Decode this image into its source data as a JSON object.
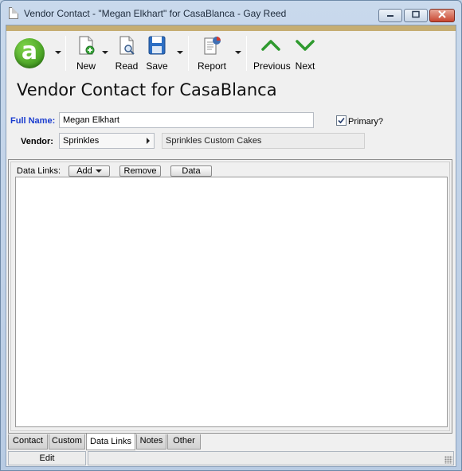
{
  "window": {
    "title": "Vendor Contact - \"Megan Elkhart\" for CasaBlanca - Gay Reed",
    "minimize_icon": "minimize-icon",
    "maximize_icon": "maximize-icon",
    "close_icon": "close-icon"
  },
  "toolbar": {
    "logo_letter": "a",
    "new_label": "New",
    "read_label": "Read",
    "save_label": "Save",
    "report_label": "Report",
    "previous_label": "Previous",
    "next_label": "Next"
  },
  "form": {
    "heading": "Vendor Contact for CasaBlanca",
    "full_name_label": "Full Name:",
    "full_name_value": "Megan Elkhart",
    "primary_label": "Primary?",
    "primary_checked": true,
    "vendor_label": "Vendor:",
    "vendor_value": "Sprinkles",
    "vendor_description": "Sprinkles Custom Cakes"
  },
  "data_links": {
    "label": "Data Links:",
    "add_label": "Add",
    "remove_label": "Remove",
    "data_label": "Data"
  },
  "tabs": [
    {
      "label": "Contact"
    },
    {
      "label": "Custom"
    },
    {
      "label": "Data Links"
    },
    {
      "label": "Notes"
    },
    {
      "label": "Other"
    }
  ],
  "active_tab": "Data Links",
  "status": {
    "mode": "Edit"
  },
  "colors": {
    "accent_gold": "#c5ad72",
    "label_blue": "#1a3ccf",
    "nav_green": "#2e9a2e"
  }
}
